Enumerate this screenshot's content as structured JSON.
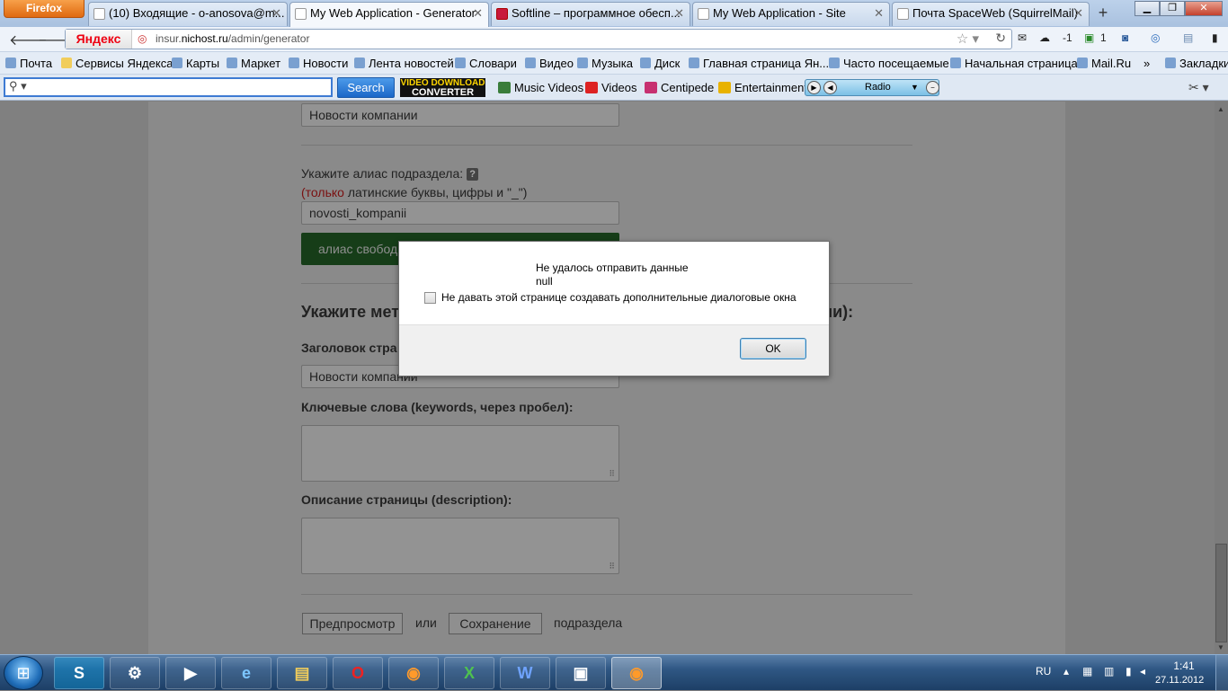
{
  "browser": {
    "menu_button": "Firefox",
    "tabs": [
      {
        "title": "(10) Входящие - o-anosova@m..."
      },
      {
        "title": "My Web Application - Generator"
      },
      {
        "title": "Softline – программное обесп..."
      },
      {
        "title": "My Web Application - Site"
      },
      {
        "title": "Почта SpaceWeb (SquirrelMail)"
      }
    ],
    "new_tab": "+",
    "yandex_label": "Яндекс",
    "url_prefix": "insur.",
    "url_domain": "nichost.ru",
    "url_path": "/admin/generator",
    "nav_right": {
      "weather": "-1",
      "mail_count": "1"
    }
  },
  "bookmarks": [
    "Почта",
    "Сервисы Яндекса",
    "Карты",
    "Маркет",
    "Новости",
    "Лента новостей",
    "Словари",
    "Видео",
    "Музыка",
    "Диск",
    "Главная страница Ян...",
    "Часто посещаемые",
    "Начальная страница",
    "Mail.Ru"
  ],
  "bookmarks_more": "»",
  "bookmarks_folder": "Закладки",
  "searchbar": {
    "input_value": "",
    "search_button": "Search",
    "vdc_line1": "VIDEO DOWNLOAD",
    "vdc_line2": "CONVERTER",
    "items": [
      "Music Videos",
      "Videos",
      "Centipede",
      "Entertainment"
    ],
    "radio_label": "Radio"
  },
  "form": {
    "section_name_value": "Новости компании",
    "alias_label": "Укажите алиас подраздела:",
    "alias_hint_open": "(",
    "alias_hint_red": "только",
    "alias_hint_rest": " латинские буквы, цифры и \"_\")",
    "alias_value": "novosti_kompanii",
    "alias_button": "алиас свобод",
    "meta_heading": "Укажите мет",
    "meta_heading_tail": "ии):",
    "page_title_label": "Заголовок стра",
    "page_title_value": "Новости компании",
    "keywords_label": "Ключевые слова (keywords, через пробел):",
    "description_label": "Описание страницы (description):",
    "preview_button": "Предпросмотр",
    "or_text": "или",
    "save_button": "Сохранение",
    "subsection_text": "подраздела"
  },
  "dialog": {
    "message_line1": "Не удалось отправить данные",
    "message_line2": "null",
    "checkbox_label": "Не давать этой странице создавать дополнительные диалоговые окна",
    "checkbox_checked": false,
    "ok_button": "OK"
  },
  "taskbar": {
    "apps": [
      "skype",
      "drivers",
      "media",
      "ie",
      "explorer",
      "opera",
      "firefox",
      "excel",
      "word",
      "picture",
      "firefox-active"
    ],
    "tray_lang": "RU",
    "clock_time": "1:41",
    "clock_date": "27.11.2012"
  },
  "colors": {
    "search_button": "#1b67c8",
    "firefox_button": "#e06a10",
    "alias_button": "#163d18",
    "hint_red": "#7a1010"
  }
}
